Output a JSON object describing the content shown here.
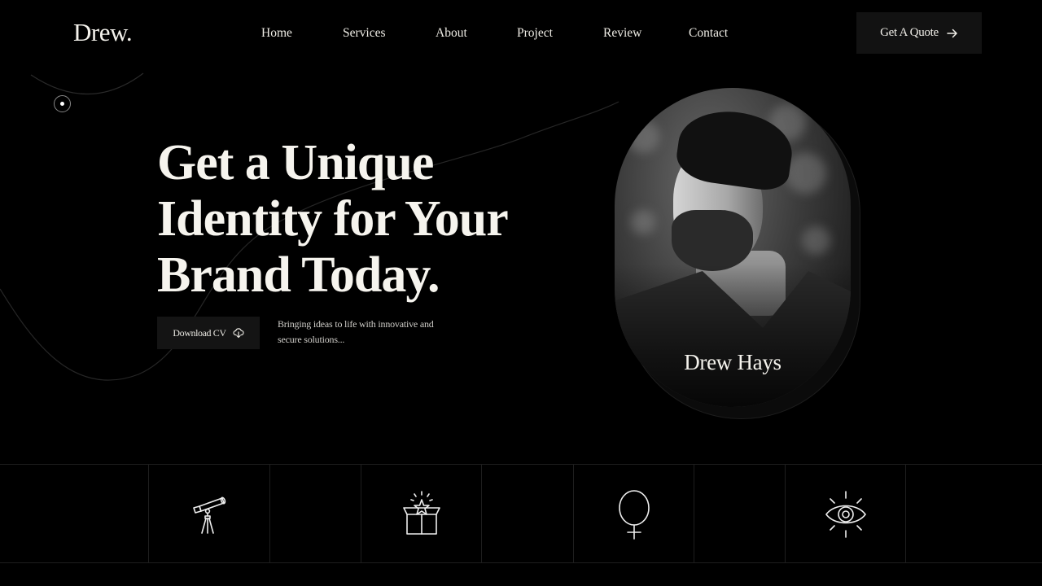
{
  "brand": {
    "logo": "Drew."
  },
  "nav": {
    "items": [
      {
        "label": "Home"
      },
      {
        "label": "Services"
      },
      {
        "label": "About"
      },
      {
        "label": "Project"
      },
      {
        "label": "Review"
      },
      {
        "label": "Contact"
      }
    ],
    "cta_label": "Get A Quote",
    "cta_icon": "arrow-right-icon"
  },
  "hero": {
    "headline_lines": [
      "Get a Unique",
      "Identity for Your",
      "Brand Today."
    ],
    "download_label": "Download CV",
    "download_icon": "cloud-download-icon",
    "tagline": "Bringing ideas to life with innovative and secure solutions..."
  },
  "portrait": {
    "name": "Drew Hays"
  },
  "features": {
    "icons": [
      "telescope-icon",
      "gift-box-star-icon",
      "female-symbol-icon",
      "eye-icon"
    ]
  },
  "colors": {
    "background": "#000000",
    "text": "#f2f0ea",
    "button_bg": "#121212",
    "divider": "#1e1e1e"
  }
}
